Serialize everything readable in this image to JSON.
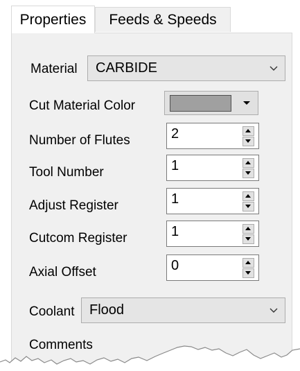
{
  "tabs": [
    {
      "label": "Properties",
      "active": true
    },
    {
      "label": "Feeds & Speeds",
      "active": false
    }
  ],
  "fields": {
    "material": {
      "label": "Material",
      "value": "CARBIDE"
    },
    "cut_material_color": {
      "label": "Cut Material Color",
      "color": "#a0a0a0"
    },
    "number_of_flutes": {
      "label": "Number of Flutes",
      "value": "2"
    },
    "tool_number": {
      "label": "Tool Number",
      "value": "1"
    },
    "adjust_register": {
      "label": "Adjust Register",
      "value": "1"
    },
    "cutcom_register": {
      "label": "Cutcom Register",
      "value": "1"
    },
    "axial_offset": {
      "label": "Axial Offset",
      "value": "0"
    },
    "coolant": {
      "label": "Coolant",
      "value": "Flood"
    },
    "comments": {
      "label": "Comments"
    }
  },
  "icons": {
    "dropdown": "chevron-down-icon",
    "spin_up": "spin-up-icon",
    "spin_down": "spin-down-icon",
    "color_dropdown": "triangle-down-icon"
  }
}
